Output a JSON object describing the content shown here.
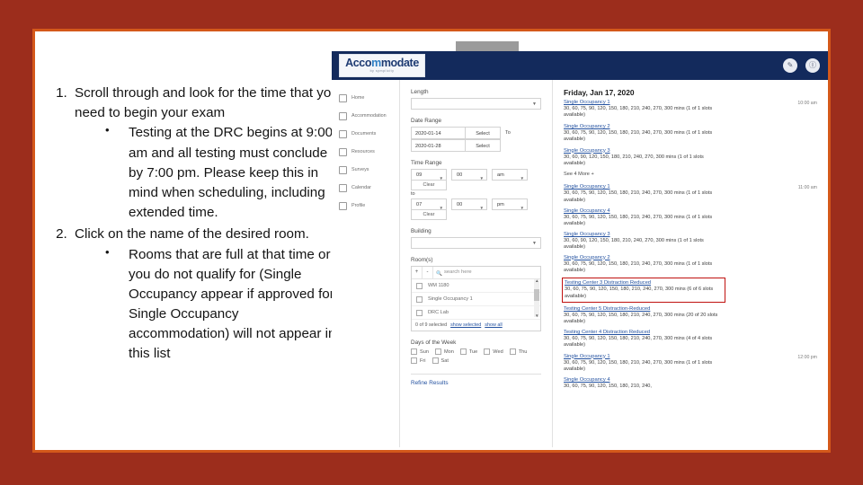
{
  "slide": {
    "border_color": "#d4581a",
    "background_color": "#9c2d1c"
  },
  "instructions": {
    "steps": [
      {
        "number": "1.",
        "text": "Scroll through and look for the time that you need to begin your exam",
        "subs": [
          "Testing at the DRC begins at 9:00 am and all testing must conclude by 7:00 pm. Please keep this in mind when scheduling, including extended time."
        ]
      },
      {
        "number": "2.",
        "text": "Click on the name of the desired room.",
        "subs": [
          "Rooms that are full at that time or you do not qualify for (Single Occupancy appear if approved for Single Occupancy accommodation) will not appear in this list"
        ]
      }
    ]
  },
  "app": {
    "appbar": {
      "color": "#132a5c",
      "logo_text": "Acco",
      "logo_accent": "m",
      "logo_rest": "modate",
      "logo_sub": "by symplicity",
      "actions": [
        {
          "name": "edit-icon",
          "glyph": "✎"
        },
        {
          "name": "user-icon",
          "glyph": "Ⓘ"
        }
      ]
    },
    "sidebar": {
      "items": [
        {
          "label": "Home",
          "icon": "home-icon"
        },
        {
          "label": "Accommodation",
          "icon": "accommodation-icon"
        },
        {
          "label": "Documents",
          "icon": "documents-icon"
        },
        {
          "label": "Resources",
          "icon": "resources-icon"
        },
        {
          "label": "Surveys",
          "icon": "surveys-icon"
        },
        {
          "label": "Calendar",
          "icon": "calendar-icon"
        },
        {
          "label": "Profile",
          "icon": "profile-icon"
        }
      ]
    },
    "filters": {
      "length_label": "Length",
      "length_value": "",
      "date_range_label": "Date Range",
      "date_from": "2020-01-14",
      "date_from_btn": "Select",
      "date_to_word": "To",
      "date_to": "2020-01-28",
      "date_to_btn": "Select",
      "time_range_label": "Time Range",
      "time_from_hour": "09",
      "time_from_min": "00",
      "time_from_ampm": "am",
      "time_from_clear": "Clear",
      "time_to_label": "to",
      "time_to_hour": "07",
      "time_to_min": "00",
      "time_to_ampm": "pm",
      "time_to_clear": "Clear",
      "building_label": "Building",
      "building_value": "",
      "rooms_label": "Room(s)",
      "rooms_add": "+",
      "rooms_remove": "-",
      "rooms_search_placeholder": "search here",
      "rooms_options": [
        "WM 1180",
        "Single Occupancy 1",
        "DRC Lab"
      ],
      "rooms_selected_count": "0 of 9 selected",
      "rooms_show_selected": "show selected",
      "rooms_show_all": "show all",
      "days_label": "Days of the Week",
      "days": [
        "Sun",
        "Mon",
        "Tue",
        "Wed",
        "Thu",
        "Fri",
        "Sat"
      ],
      "refine_label": "Refine Results"
    },
    "results": {
      "date_heading": "Friday, Jan 17, 2020",
      "see_more": "See 4 More +",
      "groups": [
        {
          "time": "10:00 am",
          "items": [
            {
              "name": "Single Occupancy 1",
              "desc": "30, 60, 75, 90, 120, 150, 180, 210, 240, 270, 300 mins (1 of 1 slots available)",
              "highlighted": false
            },
            {
              "name": "Single Occupancy 2",
              "desc": "30, 60, 75, 90, 120, 150, 180, 210, 240, 270, 300 mins (1 of 1 slots available)",
              "highlighted": false
            },
            {
              "name": "Single Occupancy 3",
              "desc": "30, 60, 90, 120, 150, 180, 210, 240, 270, 300 mins (1 of 1 slots available)",
              "highlighted": false
            }
          ]
        },
        {
          "time": "11:00 am",
          "items": [
            {
              "name": "Single Occupancy 1",
              "desc": "30, 60, 75, 90, 120, 150, 180, 210, 240, 270, 300 mins (1 of 1 slots available)",
              "highlighted": false
            },
            {
              "name": "Single Occupancy 4",
              "desc": "30, 60, 75, 90, 120, 150, 180, 210, 240, 270, 300 mins (1 of 1 slots available)",
              "highlighted": false
            },
            {
              "name": "Single Occupancy 3",
              "desc": "30, 60, 90, 120, 150, 180, 210, 240, 270, 300 mins (1 of 1 slots available)",
              "highlighted": false
            },
            {
              "name": "Single Occupancy 2",
              "desc": "30, 60, 75, 90, 120, 150, 180, 210, 240, 270, 300 mins (1 of 1 slots available)",
              "highlighted": false
            },
            {
              "name": "Testing Center 3 Distraction Reduced",
              "desc": "30, 60, 75, 90, 120, 150, 180, 210, 240, 270, 300 mins (6 of 6 slots available)",
              "highlighted": true
            },
            {
              "name": "Testing Center 5 Distraction-Reduced",
              "desc": "30, 60, 75, 90, 120, 150, 180, 210, 240, 270, 300 mins (20 of 20 slots available)",
              "highlighted": false
            },
            {
              "name": "Testing Center 4 Distraction Reduced",
              "desc": "30, 60, 75, 90, 120, 150, 180, 210, 240, 270, 300 mins (4 of 4 slots available)",
              "highlighted": false
            }
          ]
        },
        {
          "time": "12:00 pm",
          "items": [
            {
              "name": "Single Occupancy 1",
              "desc": "30, 60, 75, 90, 120, 150, 180, 210, 240, 270, 300 mins (1 of 1 slots available)",
              "highlighted": false
            },
            {
              "name": "Single Occupancy 4",
              "desc": "30, 60, 75, 90, 120, 150, 180, 210, 240,",
              "highlighted": false
            }
          ]
        }
      ]
    }
  }
}
